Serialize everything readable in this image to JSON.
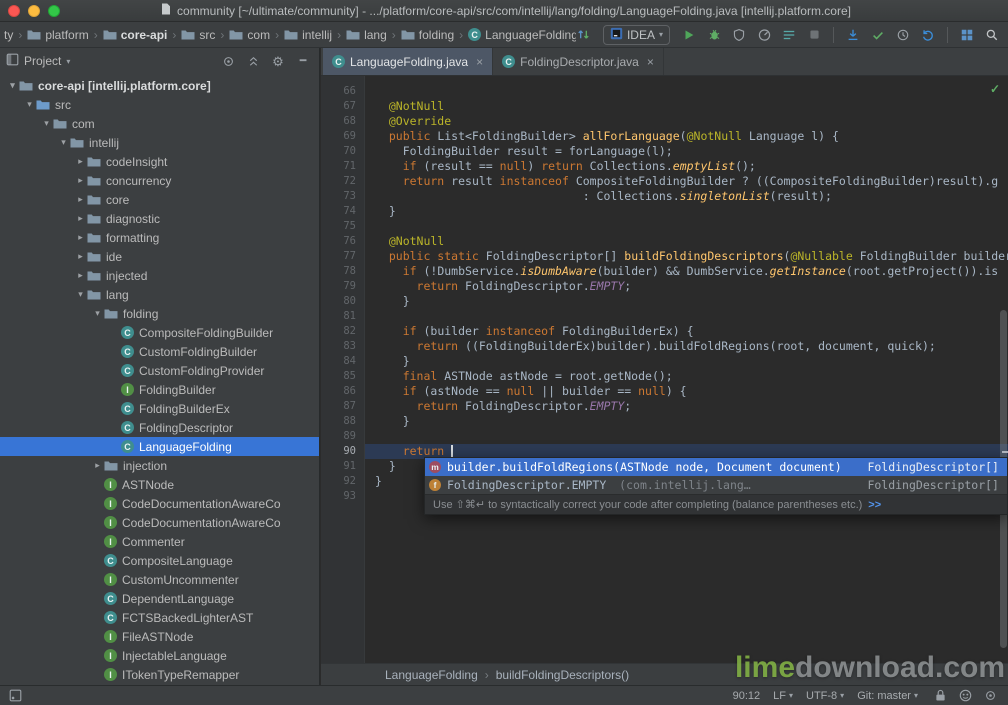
{
  "window": {
    "title": "community [~/ultimate/community] - .../platform/core-api/src/com/intellij/lang/folding/LanguageFolding.java [intellij.platform.core]"
  },
  "colors": {
    "panel_background": "#3C3F41",
    "editor_background": "#2B2B2B",
    "selection_blue": "#3875D6",
    "completion_selection_blue": "#3B6EC9",
    "keyword_orange": "#CC7832",
    "annotation_yellow": "#BBB529",
    "static_field_purple": "#9876AA",
    "run_green": "#4FA65A"
  },
  "navbar": {
    "separator": "›",
    "crumbs": [
      {
        "label": "ty",
        "icon": ""
      },
      {
        "label": "platform",
        "icon": "folder"
      },
      {
        "label": "core-api",
        "icon": "folder",
        "bold": true
      },
      {
        "label": "src",
        "icon": "folder"
      },
      {
        "label": "com",
        "icon": "folder"
      },
      {
        "label": "intellij",
        "icon": "folder"
      },
      {
        "label": "lang",
        "icon": "folder"
      },
      {
        "label": "folding",
        "icon": "folder"
      },
      {
        "label": "LanguageFolding",
        "icon": "class"
      }
    ],
    "run_config": "IDEA",
    "toolbar": {
      "left_group": [
        "sync-arrows"
      ],
      "run_group": [
        "run",
        "debug",
        "coverage",
        "profiler",
        "structure",
        "stop"
      ],
      "vcs_group": [
        "vcs-update",
        "vcs-commit",
        "vcs-history",
        "vcs-rollback"
      ],
      "window_group": [
        "tool-windows",
        "search-everywhere"
      ]
    }
  },
  "project_panel": {
    "title": "Project",
    "header_icons": [
      "locate",
      "collapse-all",
      "settings-gear",
      "hide"
    ],
    "tree": [
      {
        "d": 0,
        "a": "v",
        "i": "module",
        "l": "core-api [intellij.platform.core]",
        "b": true
      },
      {
        "d": 1,
        "a": "v",
        "i": "src",
        "l": "src"
      },
      {
        "d": 2,
        "a": "v",
        "i": "folder",
        "l": "com"
      },
      {
        "d": 3,
        "a": "v",
        "i": "folder",
        "l": "intellij"
      },
      {
        "d": 4,
        "a": ">",
        "i": "folder",
        "l": "codeInsight"
      },
      {
        "d": 4,
        "a": ">",
        "i": "folder",
        "l": "concurrency"
      },
      {
        "d": 4,
        "a": ">",
        "i": "folder",
        "l": "core"
      },
      {
        "d": 4,
        "a": ">",
        "i": "folder",
        "l": "diagnostic"
      },
      {
        "d": 4,
        "a": ">",
        "i": "folder",
        "l": "formatting"
      },
      {
        "d": 4,
        "a": ">",
        "i": "folder",
        "l": "ide"
      },
      {
        "d": 4,
        "a": ">",
        "i": "folder",
        "l": "injected"
      },
      {
        "d": 4,
        "a": "v",
        "i": "folder",
        "l": "lang"
      },
      {
        "d": 5,
        "a": "v",
        "i": "folder",
        "l": "folding"
      },
      {
        "d": 6,
        "a": "",
        "i": "class",
        "l": "CompositeFoldingBuilder"
      },
      {
        "d": 6,
        "a": "",
        "i": "class",
        "l": "CustomFoldingBuilder"
      },
      {
        "d": 6,
        "a": "",
        "i": "class",
        "l": "CustomFoldingProvider"
      },
      {
        "d": 6,
        "a": "",
        "i": "interface",
        "l": "FoldingBuilder"
      },
      {
        "d": 6,
        "a": "",
        "i": "class",
        "l": "FoldingBuilderEx"
      },
      {
        "d": 6,
        "a": "",
        "i": "class",
        "l": "FoldingDescriptor"
      },
      {
        "d": 6,
        "a": "",
        "i": "class",
        "l": "LanguageFolding",
        "sel": true
      },
      {
        "d": 5,
        "a": ">",
        "i": "folder",
        "l": "injection"
      },
      {
        "d": 5,
        "a": "",
        "i": "interface",
        "l": "ASTNode"
      },
      {
        "d": 5,
        "a": "",
        "i": "interface",
        "l": "CodeDocumentationAwareCo"
      },
      {
        "d": 5,
        "a": "",
        "i": "interface",
        "l": "CodeDocumentationAwareCo"
      },
      {
        "d": 5,
        "a": "",
        "i": "interface",
        "l": "Commenter"
      },
      {
        "d": 5,
        "a": "",
        "i": "class",
        "l": "CompositeLanguage"
      },
      {
        "d": 5,
        "a": "",
        "i": "interface",
        "l": "CustomUncommenter"
      },
      {
        "d": 5,
        "a": "",
        "i": "class",
        "l": "DependentLanguage"
      },
      {
        "d": 5,
        "a": "",
        "i": "class",
        "l": "FCTSBackedLighterAST"
      },
      {
        "d": 5,
        "a": "",
        "i": "interface",
        "l": "FileASTNode"
      },
      {
        "d": 5,
        "a": "",
        "i": "interface",
        "l": "InjectableLanguage"
      },
      {
        "d": 5,
        "a": "",
        "i": "interface",
        "l": "ITokenTypeRemapper"
      }
    ]
  },
  "editor_tabs": [
    {
      "label": "LanguageFolding.java",
      "active": true
    },
    {
      "label": "FoldingDescriptor.java",
      "active": false
    }
  ],
  "editor": {
    "lines": [
      {
        "n": 66,
        "s": []
      },
      {
        "n": 67,
        "s": [
          [
            "ann",
            "  @NotNull"
          ]
        ]
      },
      {
        "n": 68,
        "s": [
          [
            "ann",
            "  @Override"
          ]
        ]
      },
      {
        "n": 69,
        "s": [
          [
            "kw",
            "  public "
          ],
          [
            "def",
            "List<FoldingBuilder> "
          ],
          [
            "mdecl",
            "allForLanguage"
          ],
          [
            "def",
            "("
          ],
          [
            "ann",
            "@NotNull"
          ],
          [
            "def",
            " Language l) {"
          ]
        ]
      },
      {
        "n": 70,
        "s": [
          [
            "def",
            "    FoldingBuilder result = forLanguage(l);"
          ]
        ]
      },
      {
        "n": 71,
        "s": [
          [
            "kw",
            "    if "
          ],
          [
            "def",
            "(result == "
          ],
          [
            "kw",
            "null"
          ],
          [
            "def",
            ") "
          ],
          [
            "kw",
            "return "
          ],
          [
            "def",
            "Collections."
          ],
          [
            "scall",
            "emptyList"
          ],
          [
            "def",
            "();"
          ]
        ]
      },
      {
        "n": 72,
        "s": [
          [
            "kw",
            "    return "
          ],
          [
            "def",
            "result "
          ],
          [
            "kw",
            "instanceof "
          ],
          [
            "def",
            "CompositeFoldingBuilder ? ((CompositeFoldingBuilder)result).g"
          ]
        ]
      },
      {
        "n": 73,
        "s": [
          [
            "def",
            "                              : Collections."
          ],
          [
            "scall",
            "singletonList"
          ],
          [
            "def",
            "(result);"
          ]
        ]
      },
      {
        "n": 74,
        "s": [
          [
            "def",
            "  }"
          ]
        ]
      },
      {
        "n": 75,
        "s": []
      },
      {
        "n": 76,
        "s": [
          [
            "ann",
            "  @NotNull"
          ]
        ]
      },
      {
        "n": 77,
        "s": [
          [
            "kw",
            "  public static "
          ],
          [
            "def",
            "FoldingDescriptor[] "
          ],
          [
            "mdecl",
            "buildFoldingDescriptors"
          ],
          [
            "def",
            "("
          ],
          [
            "ann",
            "@Nullable"
          ],
          [
            "def",
            " FoldingBuilder builder"
          ]
        ]
      },
      {
        "n": 78,
        "s": [
          [
            "kw",
            "    if "
          ],
          [
            "def",
            "(!DumbService."
          ],
          [
            "scall",
            "isDumbAware"
          ],
          [
            "def",
            "(builder) && DumbService."
          ],
          [
            "scall",
            "getInstance"
          ],
          [
            "def",
            "(root.getProject()).is"
          ]
        ]
      },
      {
        "n": 79,
        "s": [
          [
            "kw",
            "      return "
          ],
          [
            "def",
            "FoldingDescriptor."
          ],
          [
            "sfield",
            "EMPTY"
          ],
          [
            "def",
            ";"
          ]
        ]
      },
      {
        "n": 80,
        "s": [
          [
            "def",
            "    }"
          ]
        ]
      },
      {
        "n": 81,
        "s": []
      },
      {
        "n": 82,
        "s": [
          [
            "kw",
            "    if "
          ],
          [
            "def",
            "(builder "
          ],
          [
            "kw",
            "instanceof "
          ],
          [
            "def",
            "FoldingBuilderEx) {"
          ]
        ]
      },
      {
        "n": 83,
        "s": [
          [
            "kw",
            "      return "
          ],
          [
            "def",
            "((FoldingBuilderEx)builder).buildFoldRegions(root, document, quick);"
          ]
        ]
      },
      {
        "n": 84,
        "s": [
          [
            "def",
            "    }"
          ]
        ]
      },
      {
        "n": 85,
        "s": [
          [
            "kw",
            "    final "
          ],
          [
            "def",
            "ASTNode astNode = root.getNode();"
          ]
        ]
      },
      {
        "n": 86,
        "s": [
          [
            "kw",
            "    if "
          ],
          [
            "def",
            "(astNode == "
          ],
          [
            "kw",
            "null "
          ],
          [
            "def",
            "|| builder == "
          ],
          [
            "kw",
            "null"
          ],
          [
            "def",
            ") {"
          ]
        ]
      },
      {
        "n": 87,
        "s": [
          [
            "kw",
            "      return "
          ],
          [
            "def",
            "FoldingDescriptor."
          ],
          [
            "sfield",
            "EMPTY"
          ],
          [
            "def",
            ";"
          ]
        ]
      },
      {
        "n": 88,
        "s": [
          [
            "def",
            "    }"
          ]
        ]
      },
      {
        "n": 89,
        "s": []
      },
      {
        "n": 90,
        "hl": true,
        "s": [
          [
            "kw",
            "    return "
          ],
          [
            "caret",
            ""
          ]
        ]
      },
      {
        "n": 91,
        "s": [
          [
            "def",
            "  }"
          ]
        ]
      },
      {
        "n": 92,
        "s": [
          [
            "def",
            "}"
          ]
        ]
      },
      {
        "n": 93,
        "s": []
      }
    ]
  },
  "completion": {
    "rows": [
      {
        "icon": "method",
        "name": "builder.buildFoldRegions(ASTNode node, Document document)",
        "type": "FoldingDescriptor[]",
        "selected": true
      },
      {
        "icon": "field",
        "name": "FoldingDescriptor.EMPTY",
        "loc": " (com.intellij.lang…",
        "type": "FoldingDescriptor[]",
        "selected": false
      }
    ],
    "hint": "Use ⇧⌘↵ to syntactically correct your code after completing (balance parentheses etc.)",
    "hint_link": ">>"
  },
  "breadcrumb_bar": {
    "items": [
      "LanguageFolding",
      "buildFoldingDescriptors()"
    ],
    "separator": "›"
  },
  "status_bar": {
    "items": [
      {
        "id": "caret-position",
        "label": "90:12",
        "chev": false
      },
      {
        "id": "line-separator",
        "label": "LF",
        "chev": true
      },
      {
        "id": "encoding",
        "label": "UTF-8",
        "chev": true
      },
      {
        "id": "vcs-branch",
        "label": "Git: master",
        "chev": true
      }
    ],
    "icons": [
      "lock",
      "hector",
      "locate"
    ]
  },
  "watermark": {
    "green": "lime",
    "gray": "download.com"
  }
}
